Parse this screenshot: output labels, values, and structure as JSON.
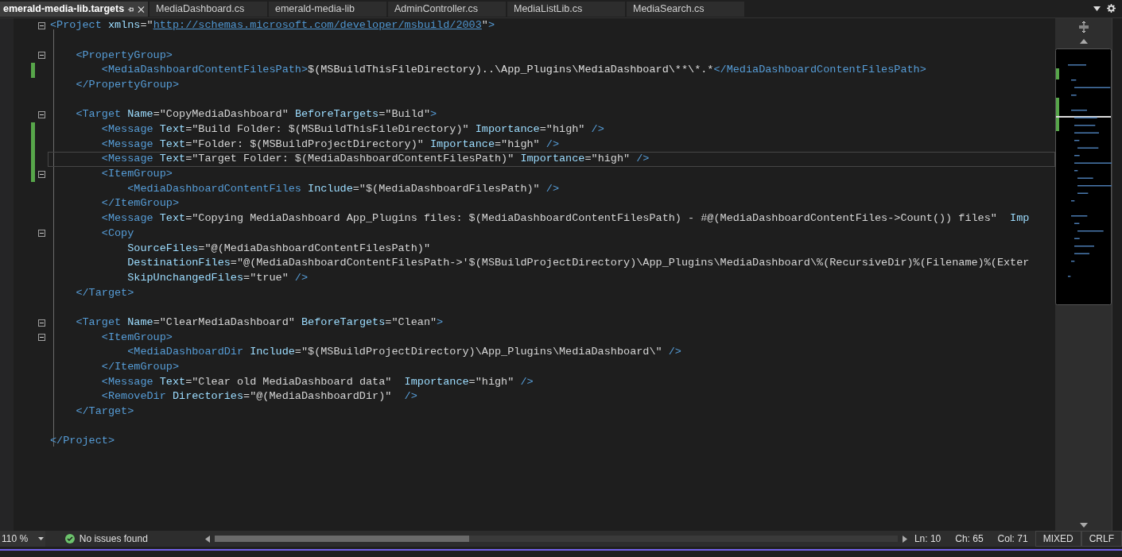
{
  "tabs": [
    {
      "label": "emerald-media-lib.targets",
      "selected": true
    },
    {
      "label": "MediaDashboard.cs",
      "selected": false
    },
    {
      "label": "emerald-media-lib",
      "selected": false
    },
    {
      "label": "AdminController.cs",
      "selected": false
    },
    {
      "label": "MediaListLib.cs",
      "selected": false
    },
    {
      "label": "MediaSearch.cs",
      "selected": false
    }
  ],
  "editor": {
    "lines": [
      {
        "kind": "code",
        "foldable": true,
        "tokens": [
          {
            "kind": "tag",
            "text": "<Project"
          },
          {
            "kind": "attr",
            "text": " xmlns"
          },
          {
            "kind": "value",
            "text": "=\""
          },
          {
            "kind": "link",
            "text": "http://schemas.microsoft.com/developer/msbuild/2003"
          },
          {
            "kind": "value",
            "text": "\""
          },
          {
            "kind": "tag",
            "text": ">"
          }
        ]
      },
      {
        "kind": "blank"
      },
      {
        "kind": "code",
        "foldable": true,
        "tokens": [
          {
            "kind": "tag",
            "text": "    <PropertyGroup>"
          }
        ]
      },
      {
        "kind": "code",
        "changed": true,
        "tokens": [
          {
            "kind": "tag",
            "text": "        <MediaDashboardContentFilesPath>"
          },
          {
            "kind": "text",
            "text": "$(MSBuildThisFileDirectory)..\\App_Plugins\\MediaDashboard\\**\\*.*"
          },
          {
            "kind": "tag",
            "text": "</MediaDashboardContentFilesPath>"
          }
        ]
      },
      {
        "kind": "code",
        "tokens": [
          {
            "kind": "tag",
            "text": "    </PropertyGroup>"
          }
        ]
      },
      {
        "kind": "blank"
      },
      {
        "kind": "code",
        "foldable": true,
        "tokens": [
          {
            "kind": "tag",
            "text": "    <Target"
          },
          {
            "kind": "attr",
            "text": " Name"
          },
          {
            "kind": "value",
            "text": "=\"CopyMediaDashboard\""
          },
          {
            "kind": "attr",
            "text": " BeforeTargets"
          },
          {
            "kind": "value",
            "text": "=\"Build\""
          },
          {
            "kind": "tag",
            "text": ">"
          }
        ]
      },
      {
        "kind": "code",
        "changed": true,
        "tokens": [
          {
            "kind": "tag",
            "text": "        <Message"
          },
          {
            "kind": "attr",
            "text": " Text"
          },
          {
            "kind": "value",
            "text": "=\"Build Folder: $(MSBuildThisFileDirectory)\""
          },
          {
            "kind": "attr",
            "text": " Importance"
          },
          {
            "kind": "value",
            "text": "=\"high\""
          },
          {
            "kind": "tag",
            "text": " />"
          }
        ]
      },
      {
        "kind": "code",
        "changed": true,
        "tokens": [
          {
            "kind": "tag",
            "text": "        <Message"
          },
          {
            "kind": "attr",
            "text": " Text"
          },
          {
            "kind": "value",
            "text": "=\"Folder: $(MSBuildProjectDirectory)\""
          },
          {
            "kind": "attr",
            "text": " Importance"
          },
          {
            "kind": "value",
            "text": "=\"high\""
          },
          {
            "kind": "tag",
            "text": " />"
          }
        ]
      },
      {
        "kind": "code",
        "changed": true,
        "current": true,
        "tokens": [
          {
            "kind": "tag",
            "text": "        <Message"
          },
          {
            "kind": "attr",
            "text": " Text"
          },
          {
            "kind": "value",
            "text": "=\"Target Folder: $(MediaDashboardContentFilesPath)\""
          },
          {
            "kind": "attr",
            "text": " Importance"
          },
          {
            "kind": "value",
            "text": "=\"high\""
          },
          {
            "kind": "tag",
            "text": " />"
          }
        ]
      },
      {
        "kind": "code",
        "changed": true,
        "foldable": true,
        "tokens": [
          {
            "kind": "tag",
            "text": "        <ItemGroup>"
          }
        ]
      },
      {
        "kind": "code",
        "tokens": [
          {
            "kind": "tag",
            "text": "            <MediaDashboardContentFiles"
          },
          {
            "kind": "attr",
            "text": " Include"
          },
          {
            "kind": "value",
            "text": "=\"$(MediaDashboardFilesPath)\""
          },
          {
            "kind": "tag",
            "text": " />"
          }
        ]
      },
      {
        "kind": "code",
        "tokens": [
          {
            "kind": "tag",
            "text": "        </ItemGroup>"
          }
        ]
      },
      {
        "kind": "code",
        "tokens": [
          {
            "kind": "tag",
            "text": "        <Message"
          },
          {
            "kind": "attr",
            "text": " Text"
          },
          {
            "kind": "value",
            "text": "=\"Copying MediaDashboard App_Plugins files: $(MediaDashboardContentFilesPath) - #@(MediaDashboardContentFiles->Count()) files\""
          },
          {
            "kind": "attr",
            "text": "  Imp"
          }
        ]
      },
      {
        "kind": "code",
        "foldable": true,
        "tokens": [
          {
            "kind": "tag",
            "text": "        <Copy"
          }
        ]
      },
      {
        "kind": "code",
        "tokens": [
          {
            "kind": "attr",
            "text": "            SourceFiles"
          },
          {
            "kind": "value",
            "text": "=\"@(MediaDashboardContentFilesPath)\""
          }
        ]
      },
      {
        "kind": "code",
        "tokens": [
          {
            "kind": "attr",
            "text": "            DestinationFiles"
          },
          {
            "kind": "value",
            "text": "=\"@(MediaDashboardContentFilesPath->'$(MSBuildProjectDirectory)\\App_Plugins\\MediaDashboard\\%(RecursiveDir)%(Filename)%(Exter"
          }
        ]
      },
      {
        "kind": "code",
        "tokens": [
          {
            "kind": "attr",
            "text": "            SkipUnchangedFiles"
          },
          {
            "kind": "value",
            "text": "=\"true\""
          },
          {
            "kind": "tag",
            "text": " />"
          }
        ]
      },
      {
        "kind": "code",
        "tokens": [
          {
            "kind": "tag",
            "text": "    </Target>"
          }
        ]
      },
      {
        "kind": "blank"
      },
      {
        "kind": "code",
        "foldable": true,
        "tokens": [
          {
            "kind": "tag",
            "text": "    <Target"
          },
          {
            "kind": "attr",
            "text": " Name"
          },
          {
            "kind": "value",
            "text": "=\"ClearMediaDashboard\""
          },
          {
            "kind": "attr",
            "text": " BeforeTargets"
          },
          {
            "kind": "value",
            "text": "=\"Clean\""
          },
          {
            "kind": "tag",
            "text": ">"
          }
        ]
      },
      {
        "kind": "code",
        "foldable": true,
        "tokens": [
          {
            "kind": "tag",
            "text": "        <ItemGroup>"
          }
        ]
      },
      {
        "kind": "code",
        "tokens": [
          {
            "kind": "tag",
            "text": "            <MediaDashboardDir"
          },
          {
            "kind": "attr",
            "text": " Include"
          },
          {
            "kind": "value",
            "text": "=\"$(MSBuildProjectDirectory)\\App_Plugins\\MediaDashboard\\\""
          },
          {
            "kind": "tag",
            "text": " />"
          }
        ]
      },
      {
        "kind": "code",
        "tokens": [
          {
            "kind": "tag",
            "text": "        </ItemGroup>"
          }
        ]
      },
      {
        "kind": "code",
        "tokens": [
          {
            "kind": "tag",
            "text": "        <Message"
          },
          {
            "kind": "attr",
            "text": " Text"
          },
          {
            "kind": "value",
            "text": "=\"Clear old MediaDashboard data\""
          },
          {
            "kind": "attr",
            "text": "  Importance"
          },
          {
            "kind": "value",
            "text": "=\"high\""
          },
          {
            "kind": "tag",
            "text": " />"
          }
        ]
      },
      {
        "kind": "code",
        "tokens": [
          {
            "kind": "tag",
            "text": "        <RemoveDir"
          },
          {
            "kind": "attr",
            "text": " Directories"
          },
          {
            "kind": "value",
            "text": "=\"@(MediaDashboardDir)\""
          },
          {
            "kind": "tag",
            "text": "  />"
          }
        ]
      },
      {
        "kind": "code",
        "tokens": [
          {
            "kind": "tag",
            "text": "    </Target>"
          }
        ]
      },
      {
        "kind": "blank"
      },
      {
        "kind": "code",
        "tokens": [
          {
            "kind": "tag",
            "text": "</Project>"
          }
        ]
      }
    ]
  },
  "status_bar": {
    "zoom": "110 %",
    "issues": "No issues found",
    "position": [
      "Ln: 10",
      "Ch: 65",
      "Col: 71"
    ],
    "formats": [
      "MIXED",
      "CRLF"
    ]
  }
}
